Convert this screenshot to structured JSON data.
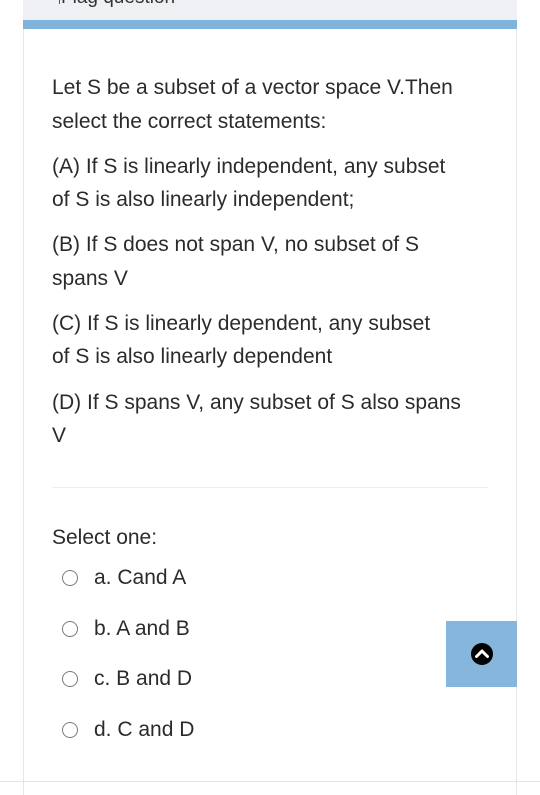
{
  "header": {
    "flag_label": "Flag question"
  },
  "question": {
    "intro_line1": "Let S be a subset of a vector space V.Then",
    "intro_line2": "select the correct statements:",
    "statements": [
      {
        "line1": "(A) If S is linearly independent, any subset",
        "line2": "of S is also linearly independent;"
      },
      {
        "line1": "(B) If S does not span V, no subset of S",
        "line2": "spans V"
      },
      {
        "line1": "(C) If S is linearly dependent, any subset",
        "line2": "of S is also linearly dependent"
      },
      {
        "line1": "(D) If S spans V, any subset of S also spans",
        "line2": "V"
      }
    ]
  },
  "answer": {
    "prompt": "Select one:",
    "options": [
      {
        "label": "a. Cand A",
        "selected": false
      },
      {
        "label": "b. A and B",
        "selected": false
      },
      {
        "label": "c. B and D",
        "selected": false
      },
      {
        "label": "d. C and D",
        "selected": false
      }
    ]
  },
  "scroll_button": {
    "icon": "chevron-up-icon"
  },
  "colors": {
    "accent_bar": "#80b3dc",
    "scroll_button_bg": "#86b6dc",
    "text": "#2b2b2b"
  }
}
